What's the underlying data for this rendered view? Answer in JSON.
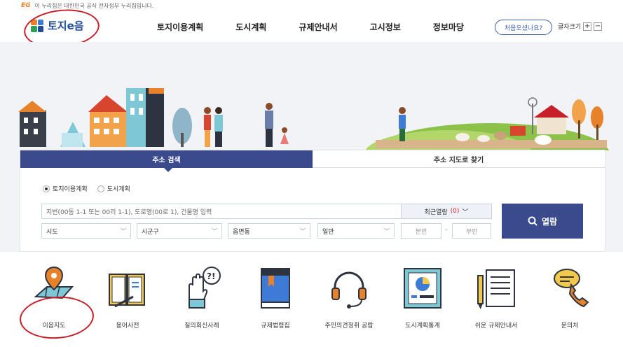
{
  "notice": {
    "eg_mark": "EG",
    "text": "이 누리집은 대한민국 공식 전자정부 누리집입니다."
  },
  "logo": {
    "name": "토지e음"
  },
  "nav": [
    "토지이용계획",
    "도시계획",
    "규제안내서",
    "고시정보",
    "정보마당"
  ],
  "header": {
    "first_visit": "처음오셨나요?",
    "font_size_label": "글자크기",
    "font_plus": "+",
    "font_minus": "−"
  },
  "search": {
    "tabs": [
      "주소 검색",
      "주소 지도로 찾기"
    ],
    "radios": [
      "토지이용계획",
      "도시계획"
    ],
    "input_placeholder": "지번(00동 1-1 또는 00리 1-1), 도로명(00로 1), 건물명 입력",
    "recent_label": "최근열람",
    "recent_count": "(0)",
    "selects": [
      "시도",
      "시군구",
      "읍면동",
      "일반"
    ],
    "bonbeon": "본번",
    "bubeon": "부번",
    "separator": "-",
    "view_button": "열람"
  },
  "services": [
    "이음지도",
    "용어사전",
    "질의회신사례",
    "규제법령집",
    "주민의견청취 공람",
    "도시계획통계",
    "쉬운 규제안내서",
    "문의처"
  ],
  "colors": {
    "primary": "#3a4a8c",
    "accent": "#e8822a",
    "annotation": "#c8202a"
  }
}
